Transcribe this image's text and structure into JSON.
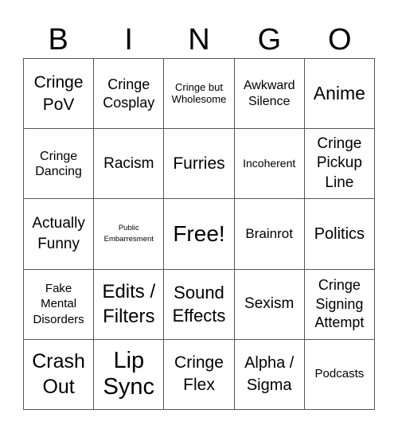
{
  "header": {
    "letters": [
      "B",
      "I",
      "N",
      "G",
      "O"
    ]
  },
  "board": {
    "rows": [
      [
        "Cringe\nPoV",
        "Cringe\nCosplay",
        "Cringe but\nWholesome",
        "Awkward\nSilence",
        "Anime"
      ],
      [
        "Cringe\nDancing",
        "Racism",
        "Furries",
        "Incoherent",
        "Cringe\nPickup\nLine"
      ],
      [
        "Actually\nFunny",
        "Public\nEmbarresment",
        "Free!",
        "Brainrot",
        "Politics"
      ],
      [
        "Fake\nMental\nDisorders",
        "Edits /\nFilters",
        "Sound\nEffects",
        "Sexism",
        "Cringe\nSigning\nAttempt"
      ],
      [
        "Crash\nOut",
        "Lip\nSync",
        "Cringe\nFlex",
        "Alpha /\nSigma",
        "Podcasts"
      ]
    ],
    "free_space": "Free!"
  }
}
